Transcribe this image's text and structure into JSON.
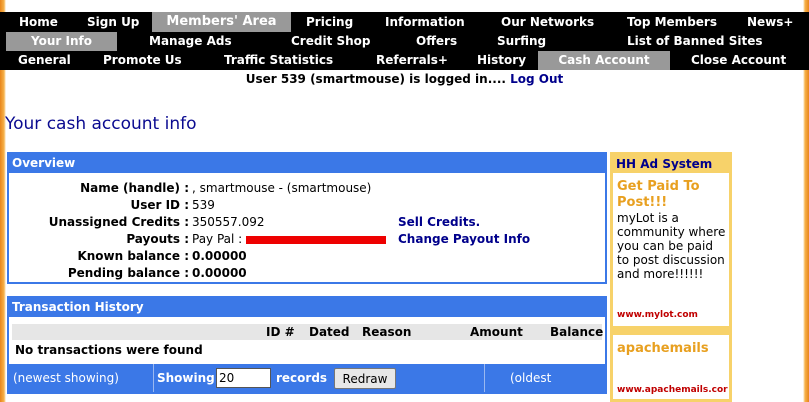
{
  "nav_row1": [
    "Home",
    "Sign Up",
    "Members' Area",
    "Pricing",
    "Information",
    "Our Networks",
    "Top Members",
    "News+"
  ],
  "nav_row2": [
    "Your Info",
    "Manage Ads",
    "Credit Shop",
    "Offers",
    "Surfing",
    "List of Banned Sites"
  ],
  "nav_row3": [
    "General",
    "Promote Us",
    "Traffic Statistics",
    "Referrals+",
    "History",
    "Cash Account",
    "Close Account"
  ],
  "login": {
    "text": "User 539 (smartmouse) is logged in....",
    "logout": "Log Out"
  },
  "page_title": "Your cash account info",
  "overview": {
    "header": "Overview",
    "rows": [
      {
        "label": "Name (handle) :",
        "value": ", smartmouse - (smartmouse)"
      },
      {
        "label": "User ID :",
        "value": "539"
      },
      {
        "label": "Unassigned Credits :",
        "value": "350557.092",
        "link": "Sell Credits."
      },
      {
        "label": "Payouts :",
        "value": "Pay Pal :",
        "link": "Change Payout Info"
      },
      {
        "label": "Known balance :",
        "value": "0.00000"
      },
      {
        "label": "Pending balance :",
        "value": "0.00000"
      }
    ]
  },
  "history": {
    "header": "Transaction History",
    "columns": [
      "ID #",
      "Dated",
      "Reason",
      "Amount",
      "Balance"
    ],
    "empty": "No transactions were found",
    "newest": "(newest showing)",
    "showing_label": "Showing",
    "showing_value": "20",
    "records_label": "records",
    "redraw": "Redraw",
    "oldest": "(oldest showing)"
  },
  "ad": {
    "header": "HH Ad System",
    "title": "Get Paid To Post!!!",
    "text": "myLot is a community where you can be paid to post discussion and more!!!!!!",
    "url": "www.mylot.com",
    "title2": "apachemails",
    "url2": "www.apachemails.cor"
  },
  "colors": {
    "panel_blue": "#3b78e7",
    "ad_yellow": "#f7d26a",
    "nav_active": "#999999",
    "link_navy": "#00008b"
  }
}
